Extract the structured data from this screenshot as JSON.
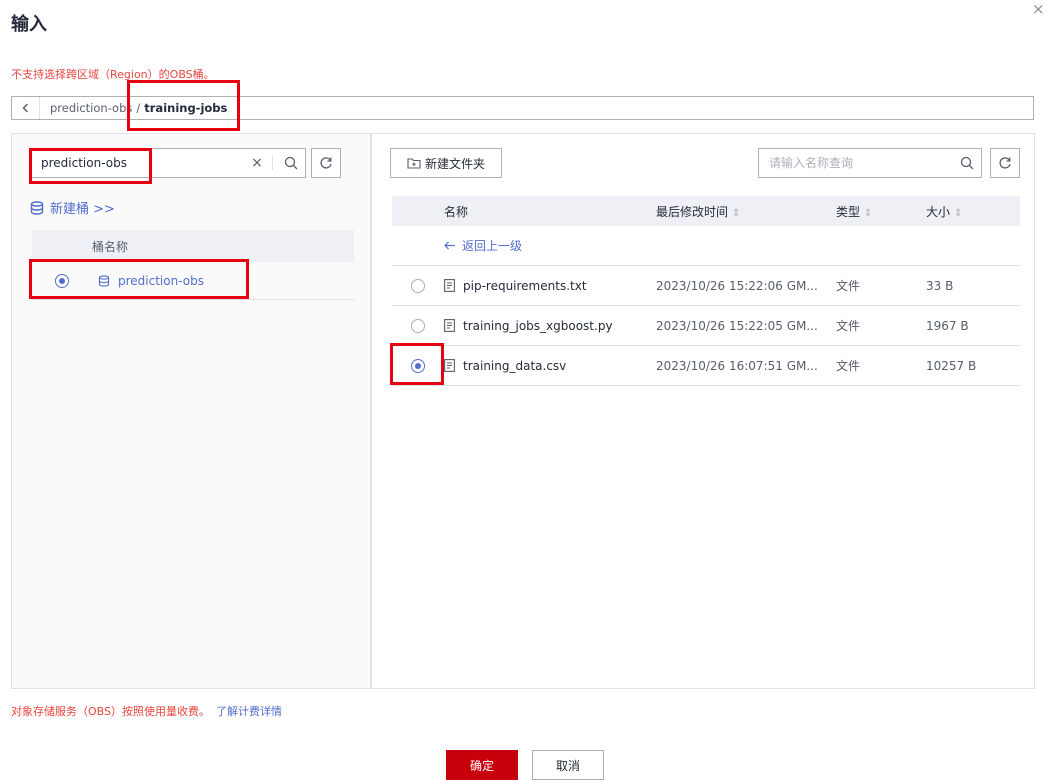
{
  "dialog": {
    "title": "输入",
    "close_glyph": "×"
  },
  "warning": {
    "text_before": "不支持选择跨区域（",
    "region": "Region",
    "text_after": "）的OBS桶。"
  },
  "path": {
    "bucket": "prediction-obs",
    "separator": "/",
    "folder": "training-jobs"
  },
  "left_panel": {
    "search_value": "prediction-obs",
    "new_bucket_label": "新建桶 >>",
    "column_header": "桶名称",
    "buckets": [
      {
        "name": "prediction-obs",
        "selected": true
      }
    ]
  },
  "right_panel": {
    "new_folder_label": "新建文件夹",
    "search_placeholder": "请输入名称查询",
    "columns": {
      "name": "名称",
      "modified": "最后修改时间",
      "type": "类型",
      "size": "大小"
    },
    "back_label": "返回上一级",
    "files": [
      {
        "name": "pip-requirements.txt",
        "modified": "2023/10/26 15:22:06 GM...",
        "type": "文件",
        "size": "33 B",
        "selected": false
      },
      {
        "name": "training_jobs_xgboost.py",
        "modified": "2023/10/26 15:22:05 GM...",
        "type": "文件",
        "size": "1967 B",
        "selected": false
      },
      {
        "name": "training_data.csv",
        "modified": "2023/10/26 16:07:51 GM...",
        "type": "文件",
        "size": "10257 B",
        "selected": true
      }
    ]
  },
  "footer": {
    "billing_note": "对象存储服务（OBS）按照使用量收费。",
    "billing_link": "了解计费详情",
    "ok_label": "确定",
    "cancel_label": "取消"
  },
  "colors": {
    "accent": "#526ecc",
    "danger": "#e6463f",
    "primary_button": "#c7000b",
    "annotation_box": "#e60012"
  }
}
